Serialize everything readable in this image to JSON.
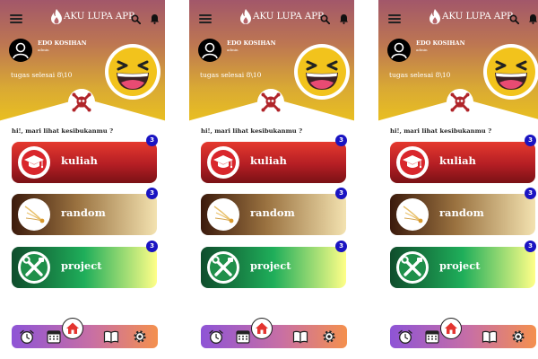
{
  "screens": [
    {
      "header": {
        "app_title": "AKU LUPA APP"
      },
      "user": {
        "name": "EDO KOSIHAN",
        "role": "admin"
      },
      "tasks_label": "tugas selesai 8\\10",
      "greeting": "hi!, mari lihat kesibukanmu ?",
      "cards": [
        {
          "label": "kuliah",
          "badge": "3"
        },
        {
          "label": "random",
          "badge": "3"
        },
        {
          "label": "project",
          "badge": "3"
        }
      ]
    },
    {
      "header": {
        "app_title": "AKU LUPA APP"
      },
      "user": {
        "name": "EDO KOSIHAN",
        "role": "admin"
      },
      "tasks_label": "tugas selesai 8\\10",
      "greeting": "hi!, mari lihat kesibukanmu ?",
      "cards": [
        {
          "label": "kuliah",
          "badge": "3"
        },
        {
          "label": "random",
          "badge": "3"
        },
        {
          "label": "project",
          "badge": "3"
        }
      ]
    },
    {
      "header": {
        "app_title": "AKU LUPA APP"
      },
      "user": {
        "name": "EDO KOSIHAN",
        "role": "admin"
      },
      "tasks_label": "tugas selesai 8\\10",
      "greeting": "hi!, mari lihat kesibukanmu ?",
      "cards": [
        {
          "label": "kuliah",
          "badge": "3"
        },
        {
          "label": "random",
          "badge": "3"
        },
        {
          "label": "project",
          "badge": "3"
        }
      ]
    }
  ],
  "icons": {
    "menu": "hamburger-menu-icon",
    "logo": "flame-logo-icon",
    "search": "search-icon",
    "notifications": "bell-icon",
    "avatar": "user-avatar-icon",
    "mood": "laughing-emoji-icon",
    "crossbones": "skull-crossbones-icon",
    "kuliah": "graduation-cap-icon",
    "random": "comet-icon",
    "project": "tools-icon",
    "nav": [
      "alarm-clock-icon",
      "calendar-icon",
      "home-icon",
      "book-icon",
      "settings-gear-icon"
    ]
  },
  "colors": {
    "header_top": "#a2576a",
    "header_bottom": "#ebc21e",
    "kuliah_card": "#c4232a",
    "random_card": "#9a7240",
    "project_card": "#1fae5a",
    "badge": "#1a14c2",
    "navbar_left": "#8e54d6",
    "navbar_right": "#f4904e"
  }
}
